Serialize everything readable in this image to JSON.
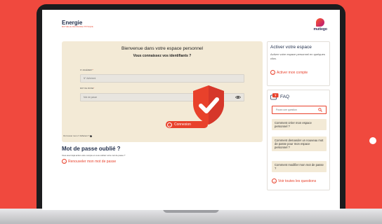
{
  "brand": {
    "name": "Energie",
    "tagline": "MUTUELLE DE FRANCE PHYSIQUE"
  },
  "partner_logo": {
    "name": "mutiego"
  },
  "login": {
    "title": "Bienvenue dans votre espace personnel",
    "subtitle": "Vous connaissez vos identifiants ?",
    "member_label": "N° ADHÉRENT",
    "member_placeholder": "N° Adhérent",
    "password_label": "MOT DE PASSE",
    "password_placeholder": "Mot de passe",
    "submit_label": "Connexion",
    "forgot_id_text": "Où trouver mon n° Adhérent ?",
    "required_marker": "*"
  },
  "forgot_password": {
    "title": "Mot de passe oublié ?",
    "description": "Vous avez déjà activé votre compte et vous oubliez votre mot de passe ?",
    "link_label": "Renouveler mon mot de passe"
  },
  "activate": {
    "title": "Activer votre espace",
    "description": "Activer votre espace personnel en quelques clics.",
    "link_label": "Activer mon compte"
  },
  "faq": {
    "title": "FAQ",
    "badge": "?",
    "search_placeholder": "Posez une question",
    "questions": [
      "Comment créer mon espace personnel ?",
      "Comment demander un nouveau mot de passe pour mon espace personnel ?",
      "Comment modifier mon mot de passe ?"
    ],
    "see_all_label": "Voir toutes les questions"
  },
  "colors": {
    "background": "#f0493e",
    "accent": "#e8412b",
    "panel": "#f3ead6",
    "navy": "#1f2d4a"
  },
  "icons": {
    "shield": "security-shield-check-icon",
    "eye": "eye-icon",
    "search": "search-icon",
    "faq": "chat-bubble-icon"
  }
}
